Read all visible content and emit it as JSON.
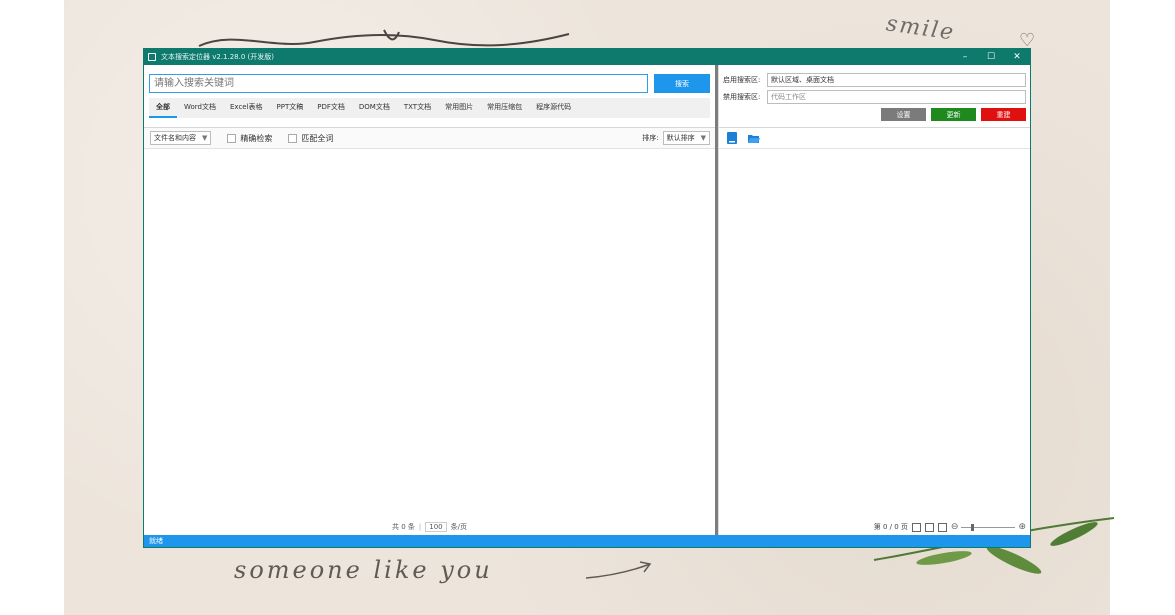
{
  "wallpaper": {
    "text_top": "smile",
    "text_bottom": "someone like you"
  },
  "window": {
    "title": "文本搜索定位器 v2.1.28.0 (开发版)",
    "minimize": "–",
    "maximize": "☐",
    "close": "✕"
  },
  "search": {
    "placeholder": "请输入搜索关键词",
    "button_label": "搜索"
  },
  "tabs": [
    {
      "label": "全部",
      "active": true
    },
    {
      "label": "Word文档"
    },
    {
      "label": "Excel表格"
    },
    {
      "label": "PPT文稿"
    },
    {
      "label": "PDF文档"
    },
    {
      "label": "DOM文档"
    },
    {
      "label": "TXT文档"
    },
    {
      "label": "常用图片"
    },
    {
      "label": "常用压缩包"
    },
    {
      "label": "程序源代码"
    }
  ],
  "filters": {
    "search_mode": "文件名和内容",
    "exact_label": "精确检索",
    "whole_word_label": "匹配全词",
    "sort_label": "排序:",
    "sort_value": "默认排序"
  },
  "pager": {
    "total": "共 0 条",
    "per_page_value": "100",
    "per_page_unit": "条/页"
  },
  "config": {
    "enabled_label": "启用搜索区:",
    "enabled_value": "默认区域、桌面文档",
    "disabled_label": "禁用搜索区:",
    "disabled_placeholder": "代码工作区",
    "buttons": [
      {
        "label": "设置",
        "color": "#7b7b7b"
      },
      {
        "label": "更新",
        "color": "#1e8a1e"
      },
      {
        "label": "重建",
        "color": "#e11010"
      }
    ]
  },
  "preview": {
    "page_info": "第 0 / 0 页"
  },
  "status": {
    "text": "就绪"
  },
  "colors": {
    "titlebar": "#0e7a6e",
    "accent": "#1e96ec"
  }
}
